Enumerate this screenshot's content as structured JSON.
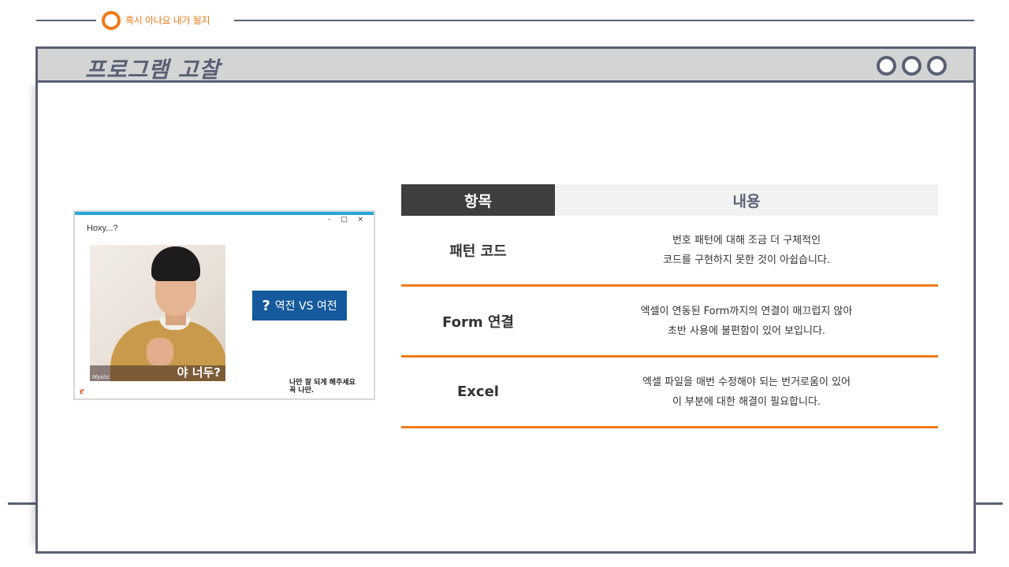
{
  "header": {
    "label": "혹시 아나요 내가 될지"
  },
  "window": {
    "title": "프로그램 고찰",
    "controls": [
      "circle-icon",
      "circle-icon",
      "circle-icon"
    ]
  },
  "program_screenshot": {
    "title": "Hoxy...?",
    "window_controls": "- □ ×",
    "photo_caption": "야 너두?",
    "photo_watermark": "Mystic",
    "button_icon": "?",
    "button_label": "역전 VS 여전",
    "note_line1": "나만 잘 되게 해주세요",
    "note_line2": "꼭 나만.",
    "corner_icon": "e"
  },
  "table": {
    "headers": {
      "item": "항목",
      "content": "내용"
    },
    "rows": [
      {
        "item": "패턴 코드",
        "line1": "번호 패턴에 대해 조금 더 구체적인",
        "line2": "코드를 구현하지 못한 것이 아쉽습니다."
      },
      {
        "item": "Form 연결",
        "line1": "엑셀이 연동된 Form까지의 연결이 매끄럽지 않아",
        "line2": "초반 사용에 불편함이 있어 보입니다."
      },
      {
        "item": "Excel",
        "line1": "엑셀 파일을 매번 수정해야 되는 번거로움이 있어",
        "line2": "이 부분에 대한 해결이 필요합니다."
      }
    ]
  },
  "colors": {
    "accent": "#f07a1a",
    "frame": "#5a6075",
    "titlebar": "#d3d4d4",
    "header_dark": "#3e3e3e",
    "button_blue": "#155a9c"
  }
}
